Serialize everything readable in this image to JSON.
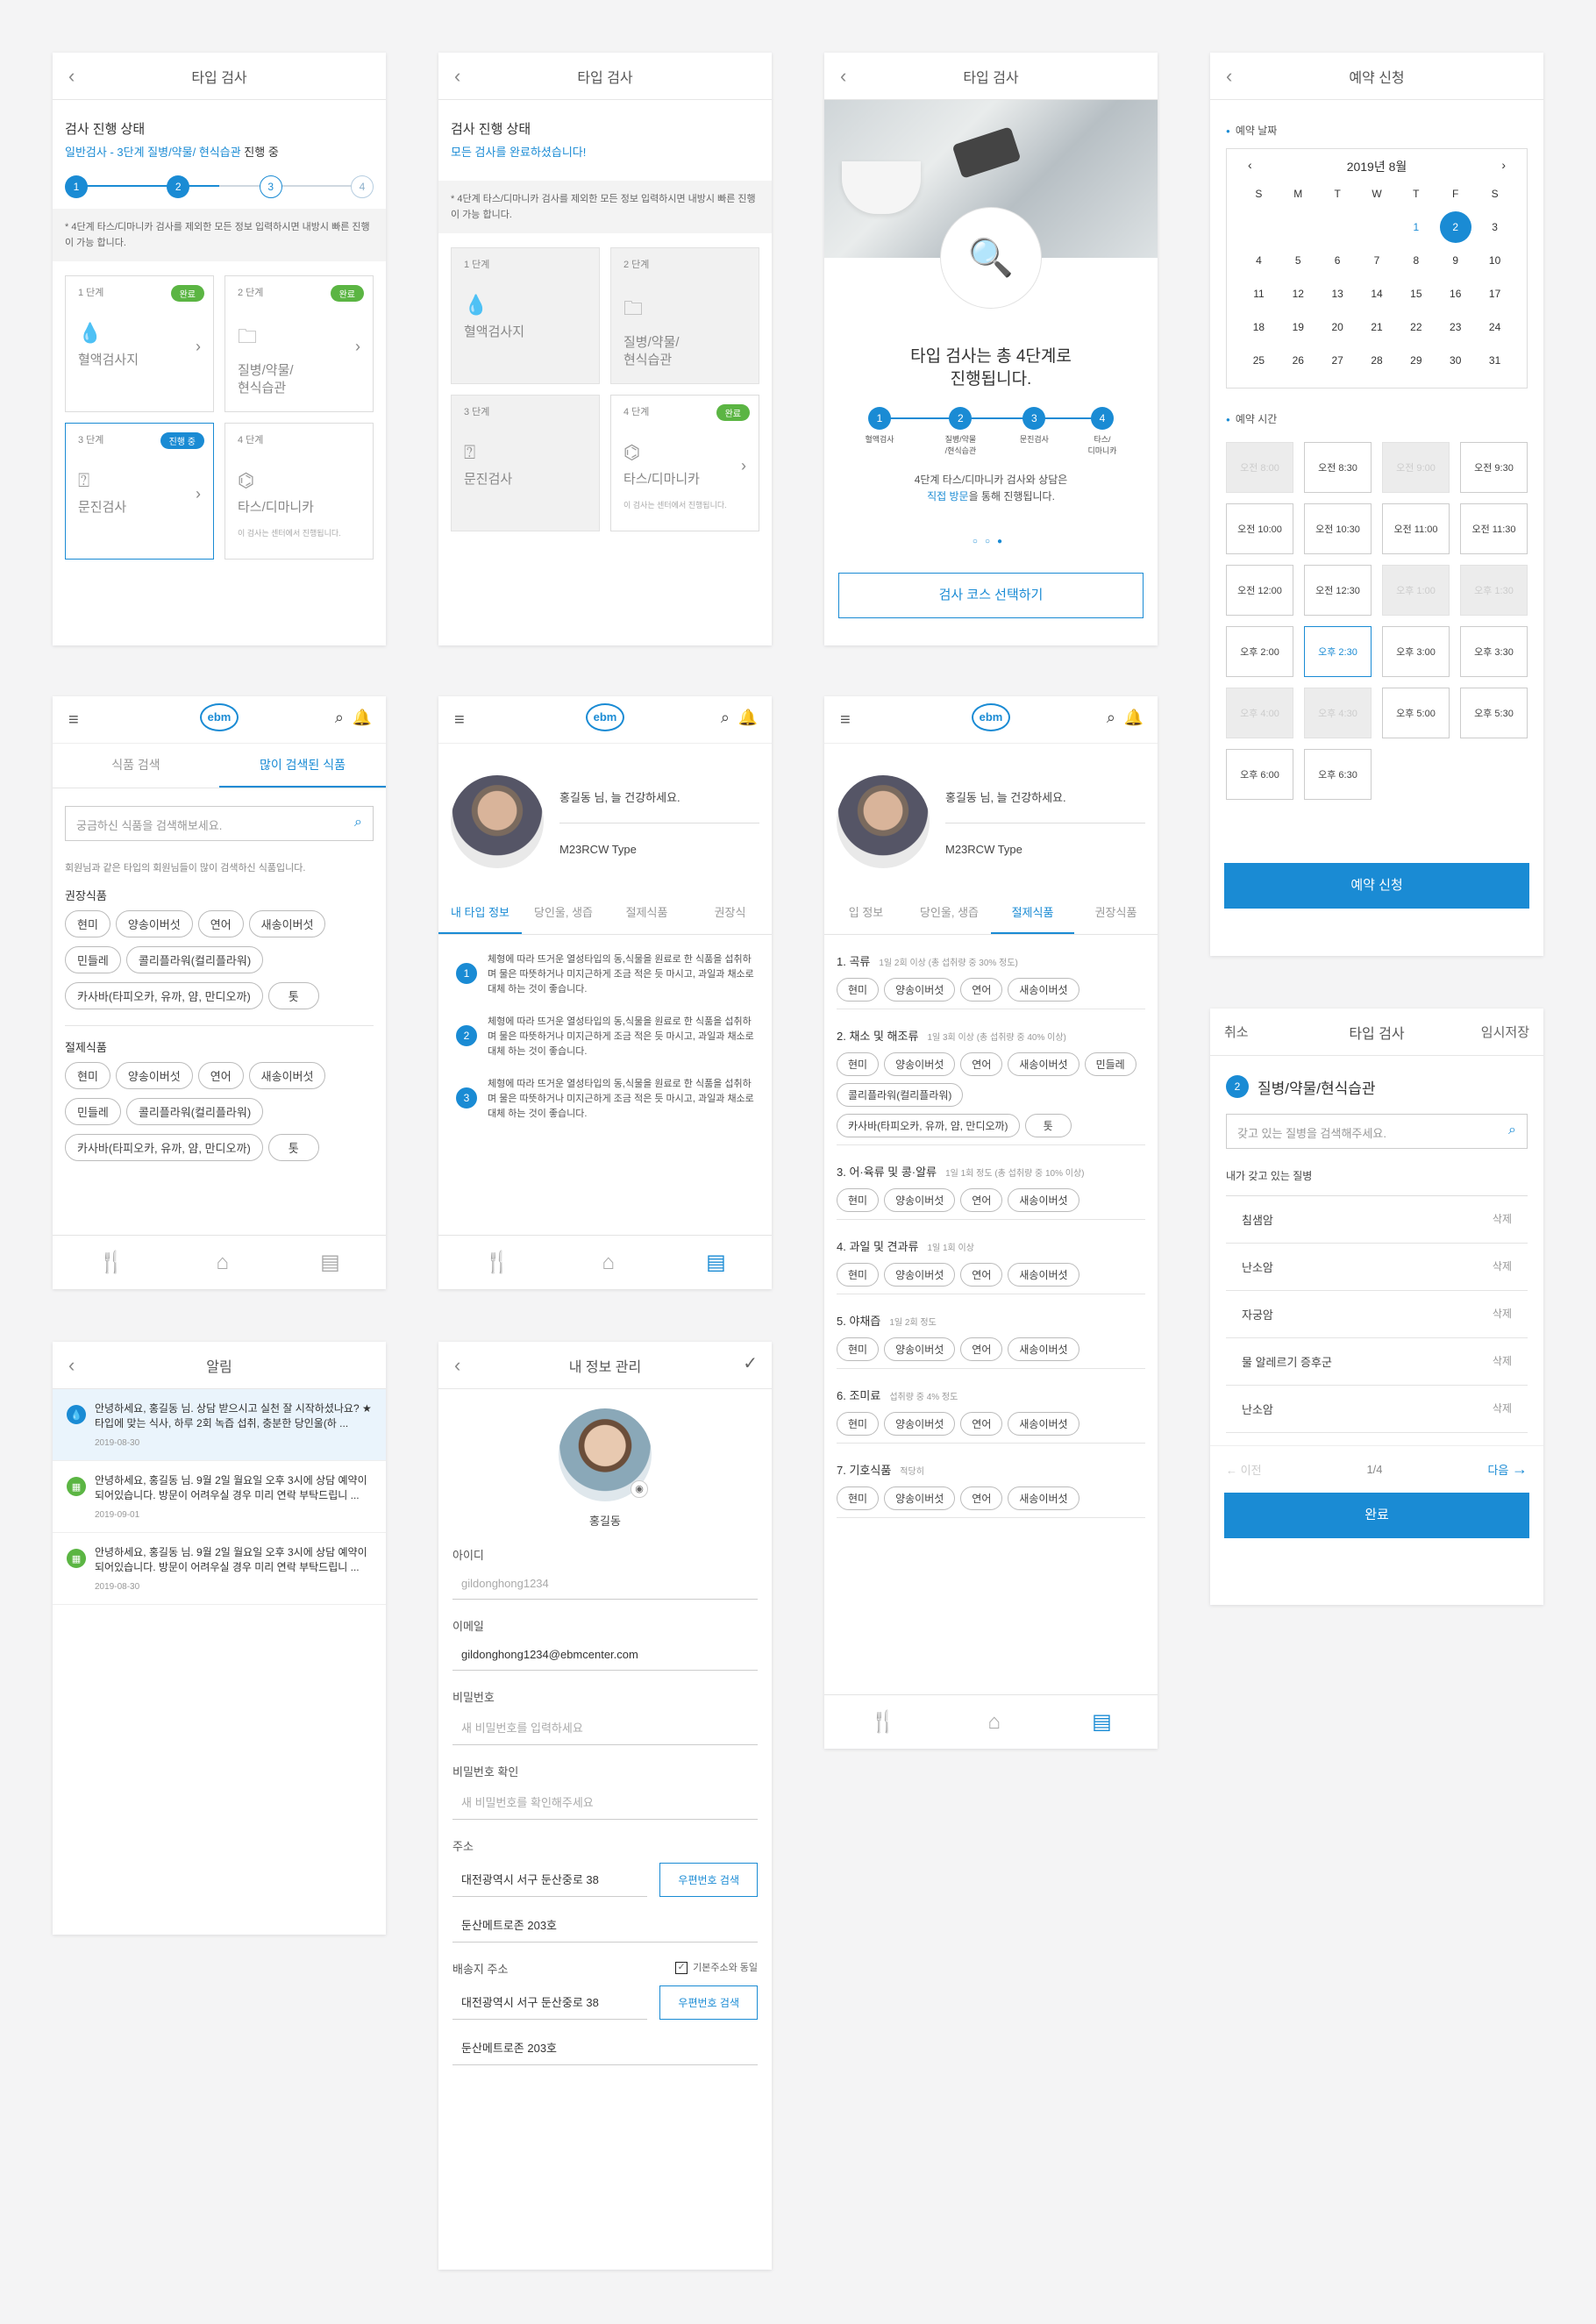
{
  "screen1": {
    "title": "타입 검사",
    "status_title": "검사 진행 상태",
    "status_sub_blue": "일반검사 - 3단계 질병/약물/ 현식습관",
    "status_sub_rest": " 진행 중",
    "steps": [
      "1",
      "2",
      "3",
      "4"
    ],
    "note": "* 4단계 타스/디마니카 검사를 제외한 모든 정보 입력하시면 내방시 빠른 진행이 가능 합니다.",
    "cards": [
      {
        "step": "1 단계",
        "badge": "완료",
        "label": "혈액검사지"
      },
      {
        "step": "2 단계",
        "badge": "완료",
        "label": "질병/약물/\n현식습관"
      },
      {
        "step": "3 단계",
        "badge": "진행 중",
        "label": "문진검사"
      },
      {
        "step": "4 단계",
        "badge": "",
        "label": "타스/디마니카",
        "small": "이 검사는 센터에서 진행됩니다."
      }
    ]
  },
  "screen2": {
    "title": "타입 검사",
    "status_title": "검사 진행 상태",
    "status_sub": "모든 검사를 완료하셨습니다!",
    "note": "* 4단계 타스/디마니카 검사를 제외한 모든 정보 입력하시면 내방시 빠른 진행이 가능 합니다.",
    "cards": [
      {
        "step": "1 단계",
        "badge": "",
        "label": "혈액검사지"
      },
      {
        "step": "2 단계",
        "badge": "",
        "label": "질병/약물/\n현식습관"
      },
      {
        "step": "3 단계",
        "badge": "",
        "label": "문진검사"
      },
      {
        "step": "4 단계",
        "badge": "완료",
        "label": "타스/디마니카",
        "small": "이 검사는 센터에서 진행됩니다."
      }
    ]
  },
  "screen3": {
    "title": "타입 검사",
    "headline": "타입 검사는 총 4단계로\n진행됩니다.",
    "steps": [
      {
        "n": "1",
        "label": "혈액검사"
      },
      {
        "n": "2",
        "label": "질병/약물\n/현식습관"
      },
      {
        "n": "3",
        "label": "문진검사"
      },
      {
        "n": "4",
        "label": "타스/\n디마니카"
      }
    ],
    "desc_1": "4단계 타스/디마니카 검사와 상담은",
    "desc_blue": "직접 방문",
    "desc_2": "을 통해 진행됩니다.",
    "button": "검사 코스 선택하기"
  },
  "screen4": {
    "title": "예약 신청",
    "date_label": "예약 날짜",
    "month": "2019년 8월",
    "weekdays": [
      "S",
      "M",
      "T",
      "W",
      "T",
      "F",
      "S"
    ],
    "days": [
      "",
      "",
      "",
      "",
      "1",
      "2",
      "3",
      "4",
      "5",
      "6",
      "7",
      "8",
      "9",
      "10",
      "11",
      "12",
      "13",
      "14",
      "15",
      "16",
      "17",
      "18",
      "19",
      "20",
      "21",
      "22",
      "23",
      "24",
      "25",
      "26",
      "27",
      "28",
      "29",
      "30",
      "31"
    ],
    "selected_day": "2",
    "time_label": "예약 시간",
    "slots": [
      {
        "t": "오전 8:00",
        "s": "dis"
      },
      {
        "t": "오전 8:30",
        "s": ""
      },
      {
        "t": "오전 9:00",
        "s": "dis"
      },
      {
        "t": "오전 9:30",
        "s": ""
      },
      {
        "t": "오전 10:00",
        "s": ""
      },
      {
        "t": "오전 10:30",
        "s": ""
      },
      {
        "t": "오전 11:00",
        "s": ""
      },
      {
        "t": "오전 11:30",
        "s": ""
      },
      {
        "t": "오전 12:00",
        "s": ""
      },
      {
        "t": "오전 12:30",
        "s": ""
      },
      {
        "t": "오후 1:00",
        "s": "dis"
      },
      {
        "t": "오후 1:30",
        "s": "dis"
      },
      {
        "t": "오후 2:00",
        "s": ""
      },
      {
        "t": "오후 2:30",
        "s": "act"
      },
      {
        "t": "오후 3:00",
        "s": ""
      },
      {
        "t": "오후 3:30",
        "s": ""
      },
      {
        "t": "오후 4:00",
        "s": "dis"
      },
      {
        "t": "오후 4:30",
        "s": "dis"
      },
      {
        "t": "오후 5:00",
        "s": ""
      },
      {
        "t": "오후 5:30",
        "s": ""
      },
      {
        "t": "오후 6:00",
        "s": ""
      },
      {
        "t": "오후 6:30",
        "s": ""
      }
    ],
    "button": "예약 신청"
  },
  "screen5": {
    "tabs": [
      "식품 검색",
      "많이 검색된 식품"
    ],
    "search_placeholder": "궁금하신 식품을 검색해보세요.",
    "hint": "회원님과 같은 타입의 회원님들이 많이 검색하신 식품입니다.",
    "group1": "권장식품",
    "group2": "절제식품",
    "pills": [
      "현미",
      "양송이버섯",
      "연어",
      "새송이버섯",
      "민들레",
      "콜리플라워(컬리플라워)",
      "카사바(타피오카, 유까, 얌, 만디오까)",
      "톳"
    ]
  },
  "screen6": {
    "greeting": "홍길동 님, 늘 건강하세요.",
    "type": "M23RCW Type",
    "tabs": [
      "내 타입 정보",
      "당인울, 생즙",
      "절제식품",
      "권장식"
    ],
    "items": [
      "체형에 따라 뜨거운 열성타입의 동,식물을 원료로 한 식품을 섭취하며 물은 따뜻하거나 미지근하게 조금 적은 듯 마시고, 과일과 채소로 대체 하는 것이 좋습니다.",
      "체형에 따라 뜨거운 열성타입의 동,식물을 원료로 한 식품을 섭취하며 물은 따뜻하거나 미지근하게 조금 적은 듯 마시고, 과일과 채소로 대체 하는 것이 좋습니다.",
      "체형에 따라 뜨거운 열성타입의 동,식물을 원료로 한 식품을 섭취하며 물은 따뜻하거나 미지근하게 조금 적은 듯 마시고, 과일과 채소로 대체 하는 것이 좋습니다."
    ]
  },
  "screen7": {
    "greeting": "홍길동 님, 늘 건강하세요.",
    "type": "M23RCW Type",
    "tabs": [
      "입 정보",
      "당인울, 생즙",
      "절제식품",
      "권장식품"
    ],
    "sections": [
      {
        "title": "1. 곡류",
        "note": "1일 2회 이상 (총 섭취량 중 30% 정도)",
        "pills": [
          "현미",
          "양송이버섯",
          "연어",
          "새송이버섯"
        ]
      },
      {
        "title": "2. 채소 및 해조류",
        "note": "1일 3회 이상 (총 섭취량 중 40% 이상)",
        "pills": [
          "현미",
          "양송이버섯",
          "연어",
          "새송이버섯",
          "민들레",
          "콜리플라워(컬리플라워)",
          "카사바(타피오카, 유까, 얌, 만디오까)",
          "톳"
        ]
      },
      {
        "title": "3. 어·육류 및 콩·알류",
        "note": "1일 1회 정도 (총 섭취량 중 10% 이상)",
        "pills": [
          "현미",
          "양송이버섯",
          "연어",
          "새송이버섯"
        ]
      },
      {
        "title": "4. 과일 및 견과류",
        "note": "1일 1회 이상",
        "pills": [
          "현미",
          "양송이버섯",
          "연어",
          "새송이버섯"
        ]
      },
      {
        "title": "5. 야채즙",
        "note": "1일 2회 정도",
        "pills": [
          "현미",
          "양송이버섯",
          "연어",
          "새송이버섯"
        ]
      },
      {
        "title": "6. 조미료",
        "note": "섭취량 중 4% 정도",
        "pills": [
          "현미",
          "양송이버섯",
          "연어",
          "새송이버섯"
        ]
      },
      {
        "title": "7. 기호식품",
        "note": "적당히",
        "pills": [
          "현미",
          "양송이버섯",
          "연어",
          "새송이버섯"
        ]
      }
    ]
  },
  "screen8": {
    "title": "타입 검사",
    "left": "취소",
    "right": "임시저장",
    "step_n": "2",
    "step_title": "질병/약물/현식습관",
    "search_placeholder": "갖고 있는 질병을 검색해주세요.",
    "list_label": "내가 갖고 있는 질병",
    "diseases": [
      "침샘암",
      "난소암",
      "자궁암",
      "물 알레르기 증후군",
      "난소암"
    ],
    "delete": "삭제",
    "prev": "이전",
    "page": "1/4",
    "next": "다음",
    "button": "완료"
  },
  "screen9": {
    "title": "알림",
    "items": [
      {
        "text": "안녕하세요, 홍길동 님. 상담 받으시고 실천 잘 시작하셨나요? ★타입에 맞는 식사, 하루 2회 녹즙 섭취, 충분한 당인울(하 ...",
        "date": "2019-08-30",
        "icon": "drop",
        "hl": true
      },
      {
        "text": "안녕하세요, 홍길동 님. 9월 2일 월요일 오후 3시에 상담 예약이 되어있습니다. 방문이 어려우실 경우 미리 연락 부탁드립니 ...",
        "date": "2019-09-01",
        "icon": "cal",
        "hl": false
      },
      {
        "text": "안녕하세요, 홍길동 님. 9월 2일 월요일 오후 3시에 상담 예약이 되어있습니다. 방문이 어려우실 경우 미리 연락 부탁드립니 ...",
        "date": "2019-08-30",
        "icon": "cal",
        "hl": false
      }
    ]
  },
  "screen10": {
    "title": "내 정보 관리",
    "name": "홍길동",
    "id_label": "아이디",
    "id_value": "gildonghong1234",
    "email_label": "이메일",
    "email_value": "gildonghong1234@ebmcenter.com",
    "pw_label": "비밀번호",
    "pw_placeholder": "새 비밀번호를 입력하세요",
    "pw2_label": "비밀번호 확인",
    "pw2_placeholder": "새 비밀번호를 확인해주세요",
    "addr_label": "주소",
    "addr1": "대전광역시 서구 둔산중로 38",
    "addr_btn": "우편번호 검색",
    "addr2": "둔산메트로존 203호",
    "ship_label": "배송지 주소",
    "ship_same": "기본주소와 동일",
    "ship1": "대전광역시 서구 둔산중로 38",
    "ship_btn": "우편번호 검색",
    "ship2": "둔산메트로존 203호"
  },
  "logo": "ebm",
  "colors": {
    "accent": "#1a8bd4",
    "done": "#5bb543"
  }
}
